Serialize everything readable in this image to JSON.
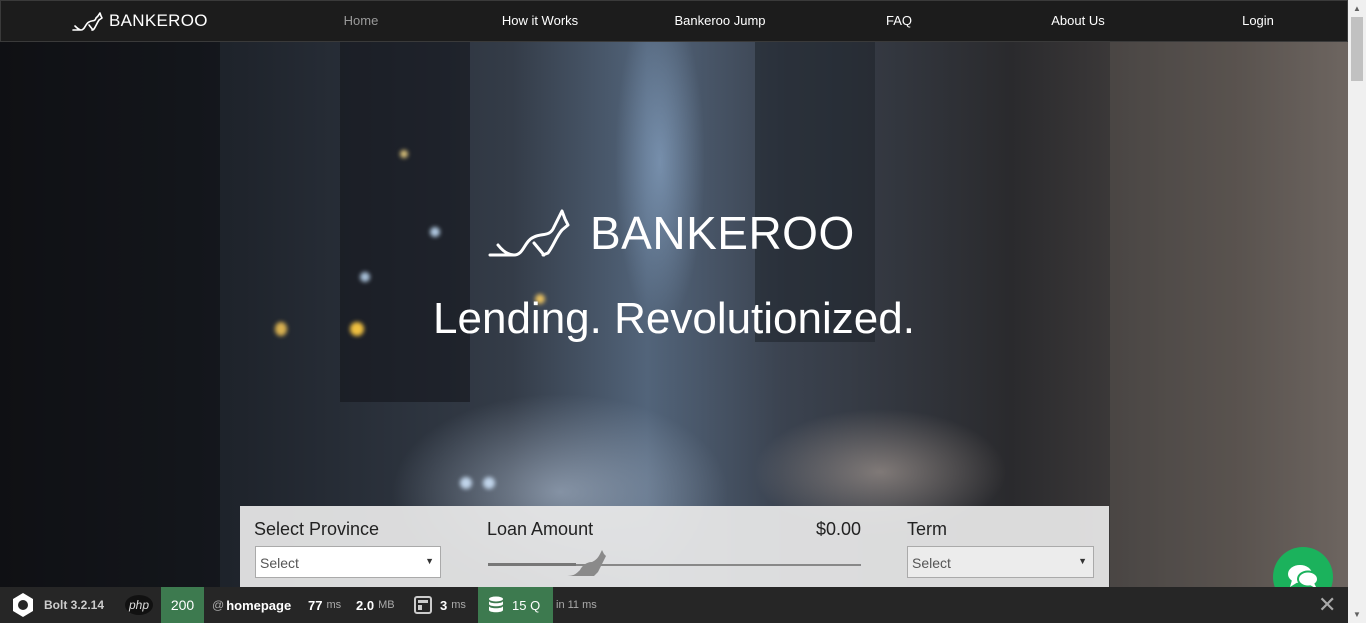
{
  "nav": {
    "brand": "BANKEROO",
    "links": [
      "Home",
      "How it Works",
      "Bankeroo Jump",
      "FAQ",
      "About Us",
      "Login"
    ],
    "active": "Home"
  },
  "hero": {
    "logo_text": "BANKEROO",
    "tagline": "Lending. Revolutionized."
  },
  "calculator": {
    "province_label": "Select Province",
    "province_value": "Select",
    "loan_label": "Loan Amount",
    "loan_amount": "$0.00",
    "slider_level": 0.23,
    "term_label": "Term",
    "term_value": "Select"
  },
  "debugbar": {
    "app": "Bolt 3.2.14",
    "php": "php",
    "status": "200",
    "at": "@",
    "route": "homepage",
    "time_value": "77",
    "time_unit": "ms",
    "memory_value": "2.0",
    "memory_unit": "MB",
    "template_value": "3",
    "template_unit": "ms",
    "queries": "15 Q",
    "queries_time": "in 11 ms",
    "close": "✕"
  },
  "colors": {
    "nav_bg": "#1c1c1c",
    "chat_green": "#1bb25c",
    "status_green": "#3d7a4f"
  },
  "icons": [
    "kangaroo-icon",
    "chat-icon",
    "bolt-icon",
    "template-icon",
    "database-icon",
    "close-icon"
  ]
}
